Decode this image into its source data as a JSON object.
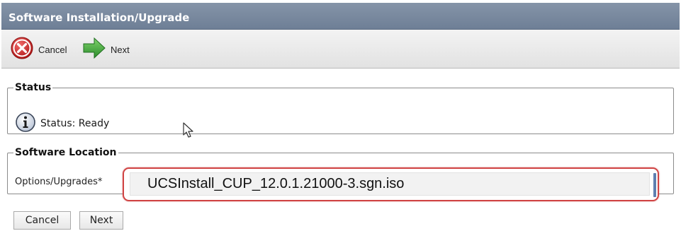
{
  "window": {
    "title": "Software Installation/Upgrade"
  },
  "toolbar": {
    "cancel_label": "Cancel",
    "next_label": "Next",
    "cancel_icon": "cancel-x-icon",
    "next_icon": "green-right-arrow-icon"
  },
  "status_section": {
    "legend": "Status",
    "icon": "info-icon",
    "status_text": "Status: Ready"
  },
  "location_section": {
    "legend": "Software Location",
    "options_label": "Options/Upgrades*",
    "selected_value": "UCSInstall_CUP_12.0.1.21000-3.sgn.iso",
    "highlight_color": "#d04444"
  },
  "bottom_buttons": {
    "cancel_label": "Cancel",
    "next_label": "Next"
  },
  "colors": {
    "title_bar": "#7a8aa0",
    "toolbar_bg": "#e8e8e8",
    "next_arrow": "#3aa63a",
    "cancel_icon": "#c8282c"
  }
}
